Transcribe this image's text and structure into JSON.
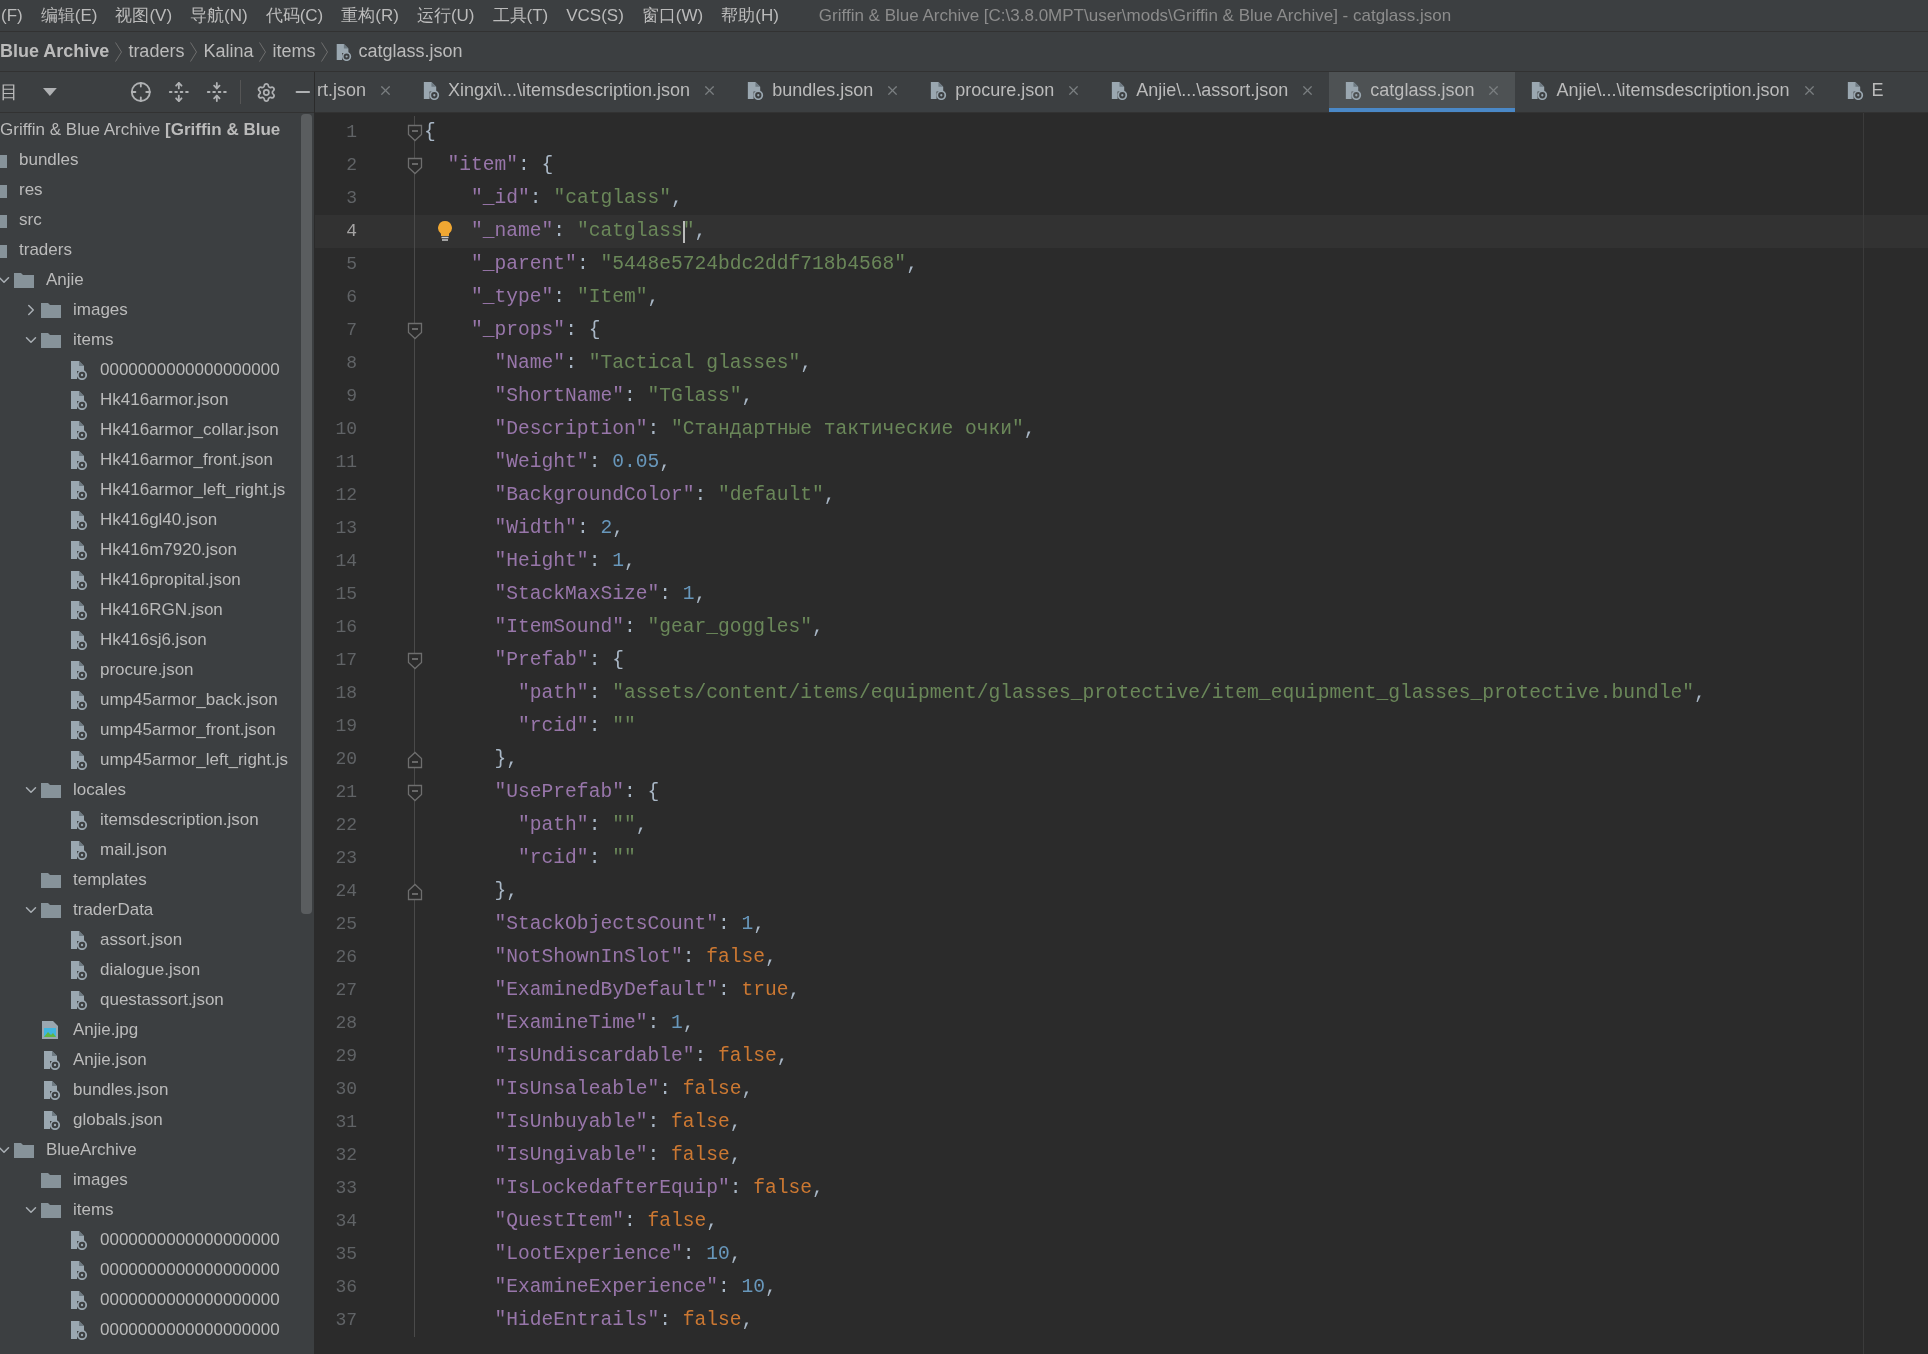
{
  "menu_bar": {
    "items": [
      "(F)",
      "编辑(E)",
      "视图(V)",
      "导航(N)",
      "代码(C)",
      "重构(R)",
      "运行(U)",
      "工具(T)",
      "VCS(S)",
      "窗口(W)",
      "帮助(H)"
    ],
    "window_title": "Griffin & Blue Archive [C:\\3.8.0MPT\\user\\mods\\Griffin & Blue Archive] - catglass.json"
  },
  "breadcrumb": [
    {
      "label": "Blue Archive",
      "kind": "project"
    },
    {
      "label": "traders",
      "kind": "folder"
    },
    {
      "label": "Kalina",
      "kind": "folder"
    },
    {
      "label": "items",
      "kind": "folder"
    },
    {
      "label": "catglass.json",
      "kind": "json"
    }
  ],
  "project_panel": {
    "title": "目",
    "tree": [
      {
        "label": "Griffin & Blue Archive **[Griffin & Blue**",
        "children": [
          {
            "label": "bundles",
            "kind": "folder"
          },
          {
            "label": "res",
            "kind": "folder"
          },
          {
            "label": "src",
            "kind": "folder"
          },
          {
            "label": "traders",
            "kind": "folder",
            "children": [
              {
                "label": "Anjie",
                "kind": "folder",
                "expanded": true,
                "children": [
                  {
                    "label": "images",
                    "kind": "folder",
                    "expanded": false
                  },
                  {
                    "label": "items",
                    "kind": "folder",
                    "expanded": true,
                    "children": [
                      {
                        "label": "0000000000000000000",
                        "kind": "json"
                      },
                      {
                        "label": "Hk416armor.json",
                        "kind": "json"
                      },
                      {
                        "label": "Hk416armor_collar.json",
                        "kind": "json"
                      },
                      {
                        "label": "Hk416armor_front.json",
                        "kind": "json"
                      },
                      {
                        "label": "Hk416armor_left_right.js",
                        "kind": "json"
                      },
                      {
                        "label": "Hk416gl40.json",
                        "kind": "json"
                      },
                      {
                        "label": "Hk416m7920.json",
                        "kind": "json"
                      },
                      {
                        "label": "Hk416propital.json",
                        "kind": "json"
                      },
                      {
                        "label": "Hk416RGN.json",
                        "kind": "json"
                      },
                      {
                        "label": "Hk416sj6.json",
                        "kind": "json"
                      },
                      {
                        "label": "procure.json",
                        "kind": "json"
                      },
                      {
                        "label": "ump45armor_back.json",
                        "kind": "json"
                      },
                      {
                        "label": "ump45armor_front.json",
                        "kind": "json"
                      },
                      {
                        "label": "ump45armor_left_right.js",
                        "kind": "json"
                      }
                    ]
                  },
                  {
                    "label": "locales",
                    "kind": "folder",
                    "expanded": true,
                    "children": [
                      {
                        "label": "itemsdescription.json",
                        "kind": "json"
                      },
                      {
                        "label": "mail.json",
                        "kind": "json"
                      }
                    ]
                  },
                  {
                    "label": "templates",
                    "kind": "folder"
                  },
                  {
                    "label": "traderData",
                    "kind": "folder",
                    "expanded": true,
                    "children": [
                      {
                        "label": "assort.json",
                        "kind": "json"
                      },
                      {
                        "label": "dialogue.json",
                        "kind": "json"
                      },
                      {
                        "label": "questassort.json",
                        "kind": "json"
                      }
                    ]
                  },
                  {
                    "label": "Anjie.jpg",
                    "kind": "image"
                  },
                  {
                    "label": "Anjie.json",
                    "kind": "json"
                  },
                  {
                    "label": "bundles.json",
                    "kind": "json"
                  },
                  {
                    "label": "globals.json",
                    "kind": "json"
                  }
                ]
              },
              {
                "label": "BlueArchive",
                "kind": "folder",
                "expanded": true,
                "children": [
                  {
                    "label": "images",
                    "kind": "folder"
                  },
                  {
                    "label": "items",
                    "kind": "folder",
                    "expanded": true,
                    "children": [
                      {
                        "label": "0000000000000000000",
                        "kind": "json"
                      },
                      {
                        "label": "0000000000000000000",
                        "kind": "json"
                      },
                      {
                        "label": "0000000000000000000",
                        "kind": "json"
                      },
                      {
                        "label": "0000000000000000000",
                        "kind": "json"
                      }
                    ]
                  }
                ]
              }
            ]
          }
        ]
      }
    ]
  },
  "editor": {
    "tabs": [
      {
        "label": "rt.json",
        "icon": false,
        "close": true,
        "selected": false
      },
      {
        "label": "Xingxi\\...\\itemsdescription.json",
        "icon": true,
        "close": true,
        "selected": false
      },
      {
        "label": "bundles.json",
        "icon": true,
        "close": true,
        "selected": false
      },
      {
        "label": "procure.json",
        "icon": true,
        "close": true,
        "selected": false
      },
      {
        "label": "Anjie\\...\\assort.json",
        "icon": true,
        "close": true,
        "selected": false
      },
      {
        "label": "catglass.json",
        "icon": true,
        "close": true,
        "selected": true
      },
      {
        "label": "Anjie\\...\\itemsdescription.json",
        "icon": true,
        "close": true,
        "selected": false
      },
      {
        "label": "E",
        "icon": true,
        "close": false,
        "selected": false
      }
    ],
    "lines": [
      {
        "number": "1",
        "text": "{",
        "kind": "block_start"
      },
      {
        "number": "2",
        "text": "  \"item\": {",
        "kind": "block_start"
      },
      {
        "number": "3",
        "text": "    \"_id\": \"catglass\",",
        "kind": "plain"
      },
      {
        "number": "4",
        "text": "    \"_name\": \"catglass",
        "rest": "\",",
        "kind": "plain",
        "current": true,
        "hint": true,
        "caret": true
      },
      {
        "number": "5",
        "text": "    \"_parent\": \"5448e5724bdc2ddf718b4568\",",
        "kind": "plain"
      },
      {
        "number": "6",
        "text": "    \"_type\": \"Item\",",
        "kind": "plain"
      },
      {
        "number": "7",
        "text": "    \"_props\": {",
        "kind": "block_start"
      },
      {
        "number": "8",
        "text": "      \"Name\": \"Tactical glasses\",",
        "kind": "plain"
      },
      {
        "number": "9",
        "text": "      \"ShortName\": \"TGlass\",",
        "kind": "plain"
      },
      {
        "number": "10",
        "text": "      \"Description\": \"Стандартные тактические очки\",",
        "kind": "plain"
      },
      {
        "number": "11",
        "text": "      \"Weight\": 0.05,",
        "kind": "plain"
      },
      {
        "number": "12",
        "text": "      \"BackgroundColor\": \"default\",",
        "kind": "plain"
      },
      {
        "number": "13",
        "text": "      \"Width\": 2,",
        "kind": "plain"
      },
      {
        "number": "14",
        "text": "      \"Height\": 1,",
        "kind": "plain"
      },
      {
        "number": "15",
        "text": "      \"StackMaxSize\": 1,",
        "kind": "plain"
      },
      {
        "number": "16",
        "text": "      \"ItemSound\": \"gear_goggles\",",
        "kind": "plain"
      },
      {
        "number": "17",
        "text": "      \"Prefab\": {",
        "kind": "block_start"
      },
      {
        "number": "18",
        "text": "        \"path\": \"assets/content/items/equipment/glasses_protective/item_equipment_glasses_protective.bundle\",",
        "kind": "plain"
      },
      {
        "number": "19",
        "text": "        \"rcid\": \"\"",
        "kind": "plain"
      },
      {
        "number": "20",
        "text": "      },",
        "kind": "block_end"
      },
      {
        "number": "21",
        "text": "      \"UsePrefab\": {",
        "kind": "block_start"
      },
      {
        "number": "22",
        "text": "        \"path\": \"\",",
        "kind": "plain"
      },
      {
        "number": "23",
        "text": "        \"rcid\": \"\"",
        "kind": "plain"
      },
      {
        "number": "24",
        "text": "      },",
        "kind": "block_end"
      },
      {
        "number": "25",
        "text": "      \"StackObjectsCount\": 1,",
        "kind": "plain"
      },
      {
        "number": "26",
        "text": "      \"NotShownInSlot\": false,",
        "kind": "plain"
      },
      {
        "number": "27",
        "text": "      \"ExaminedByDefault\": true,",
        "kind": "plain"
      },
      {
        "number": "28",
        "text": "      \"ExamineTime\": 1,",
        "kind": "plain"
      },
      {
        "number": "29",
        "text": "      \"IsUndiscardable\": false,",
        "kind": "plain"
      },
      {
        "number": "30",
        "text": "      \"IsUnsaleable\": false,",
        "kind": "plain"
      },
      {
        "number": "31",
        "text": "      \"IsUnbuyable\": false,",
        "kind": "plain"
      },
      {
        "number": "32",
        "text": "      \"IsUngivable\": false,",
        "kind": "plain"
      },
      {
        "number": "33",
        "text": "      \"IsLockedafterEquip\": false,",
        "kind": "plain"
      },
      {
        "number": "34",
        "text": "      \"QuestItem\": false,",
        "kind": "plain"
      },
      {
        "number": "35",
        "text": "      \"LootExperience\": 10,",
        "kind": "plain"
      },
      {
        "number": "36",
        "text": "      \"ExamineExperience\": 10,",
        "kind": "plain"
      },
      {
        "number": "37",
        "text": "      \"HideEntrails\": false,",
        "kind": "plain"
      }
    ]
  }
}
